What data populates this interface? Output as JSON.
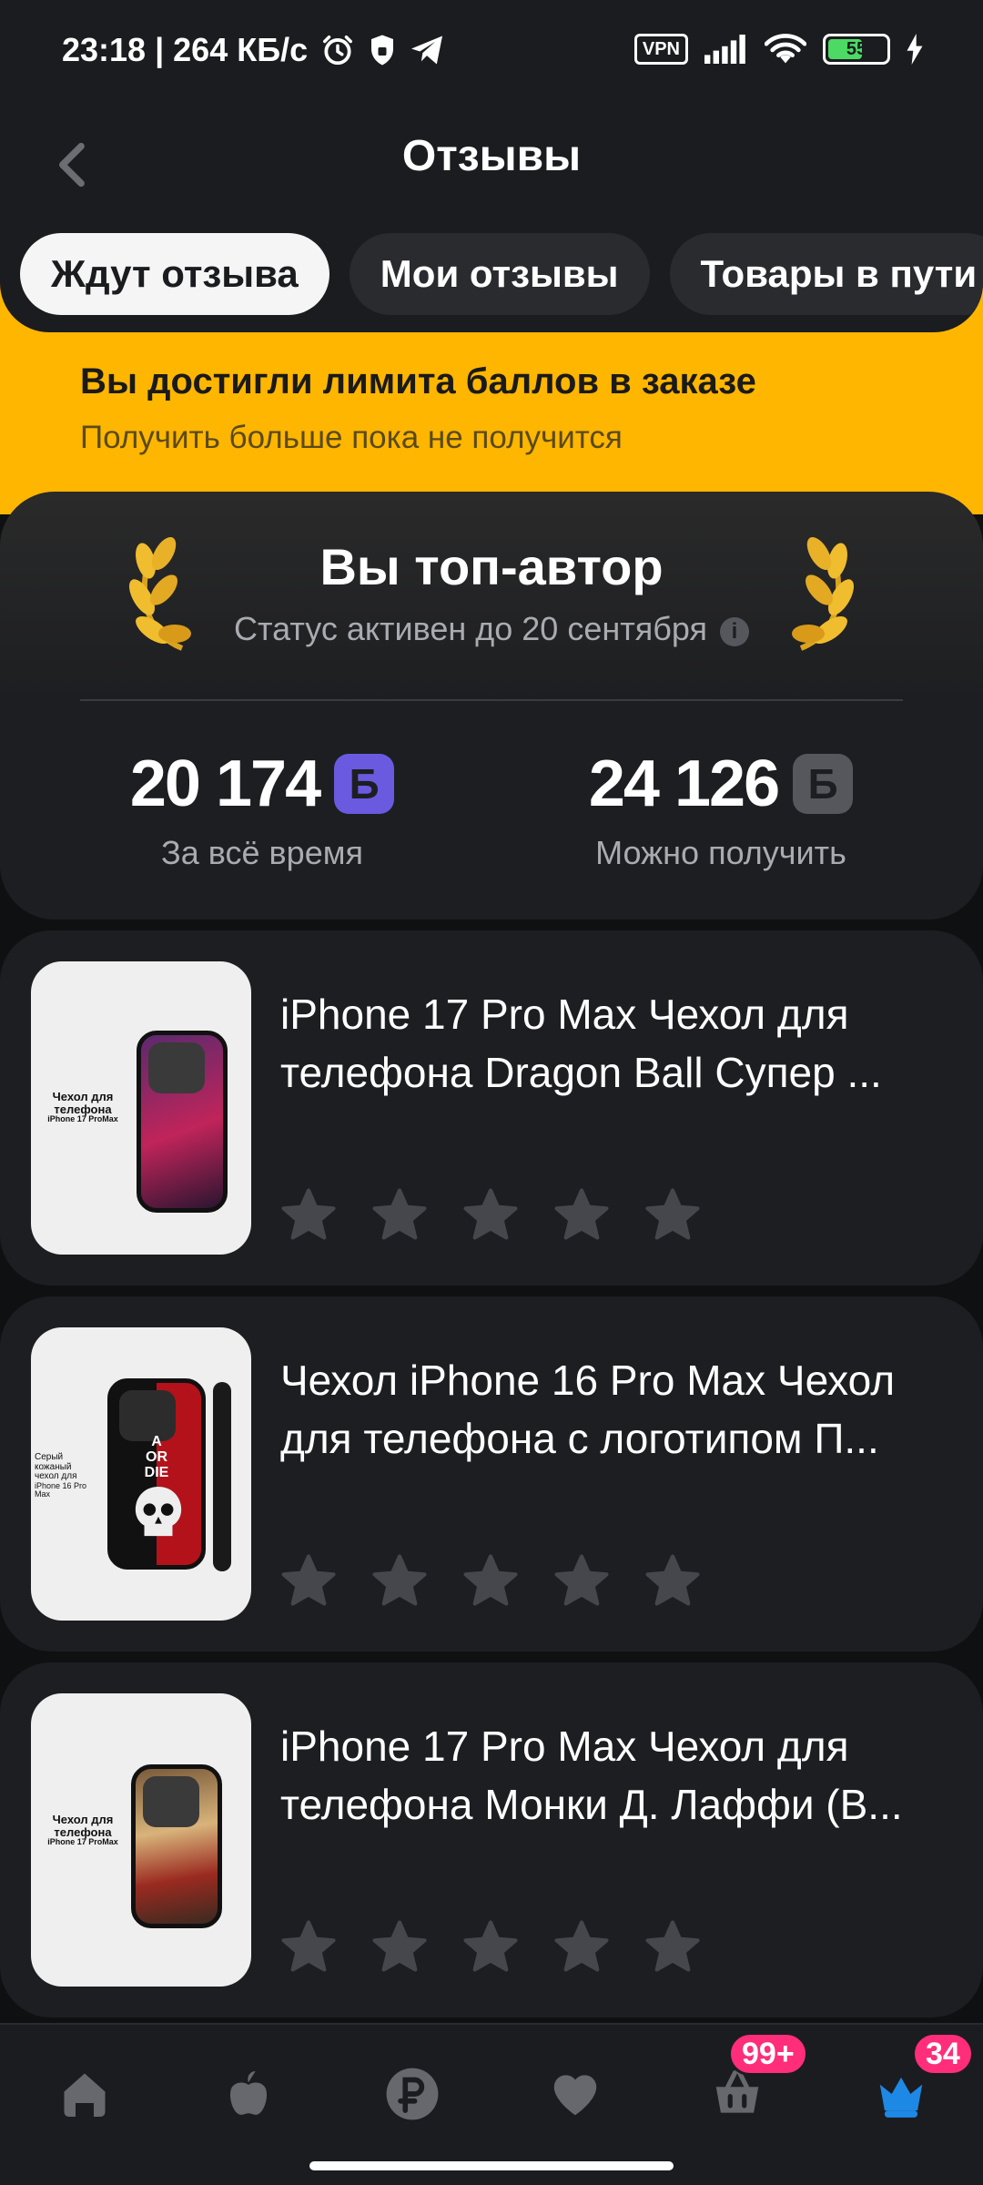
{
  "status_bar": {
    "time_speed": "23:18 | 264 КБ/с",
    "vpn_label": "VPN",
    "battery_level": "55",
    "icons": [
      "alarm-icon",
      "shield-icon",
      "telegram-icon",
      "signal-icon",
      "wifi-icon",
      "battery-icon",
      "charging-icon"
    ]
  },
  "header": {
    "title": "Отзывы",
    "back_icon": "chevron-left-icon"
  },
  "tabs": [
    {
      "label": "Ждут отзыва",
      "active": true
    },
    {
      "label": "Мои отзывы",
      "active": false
    },
    {
      "label": "Товары в пути",
      "active": false
    }
  ],
  "banner": {
    "title": "Вы достигли лимита баллов в заказе",
    "subtitle": "Получить больше пока не получится",
    "color": "#ffb600"
  },
  "top_author": {
    "title": "Вы топ-автор",
    "subtitle": "Статус активен до 20 сентября",
    "info_icon": "info-icon",
    "stats": [
      {
        "value": "20 174",
        "coin": "Б",
        "coin_color": "#6a5ae0",
        "label": "За всё время"
      },
      {
        "value": "24 126",
        "coin": "Б",
        "coin_color": "#55575c",
        "label": "Можно получить"
      }
    ]
  },
  "products": [
    {
      "title": "iPhone 17 Pro Max Чехол для телефона Dragon Ball Супер ...",
      "image_caption": [
        "Чехол для",
        "телефона",
        "iPhone 17 ProMax"
      ],
      "rating": 0,
      "max_rating": 5
    },
    {
      "title": "Чехол iPhone 16 Pro Max Чехол для телефона с логотипом П...",
      "image_caption": [
        "Серый",
        "кожаный",
        "чехол для",
        "iPhone 16 Pro Max"
      ],
      "case_text": [
        "A",
        "OR",
        "DIE"
      ],
      "rating": 0,
      "max_rating": 5
    },
    {
      "title": "iPhone 17 Pro Max Чехол для телефона Монки Д. Лаффи (В...",
      "image_caption": [
        "Чехол для",
        "телефона",
        "iPhone 17 ProMax"
      ],
      "rating": 0,
      "max_rating": 5
    }
  ],
  "bottom_nav": {
    "items": [
      {
        "name": "home",
        "icon": "home-icon"
      },
      {
        "name": "catalog",
        "icon": "apple-icon"
      },
      {
        "name": "finance",
        "icon": "ruble-icon"
      },
      {
        "name": "favorites",
        "icon": "heart-icon"
      },
      {
        "name": "cart",
        "icon": "basket-icon",
        "badge": "99+"
      },
      {
        "name": "profile",
        "icon": "crown-icon",
        "badge": "34"
      }
    ],
    "badge_color": "#ff2d7a",
    "active_color": "#1e88e5"
  }
}
